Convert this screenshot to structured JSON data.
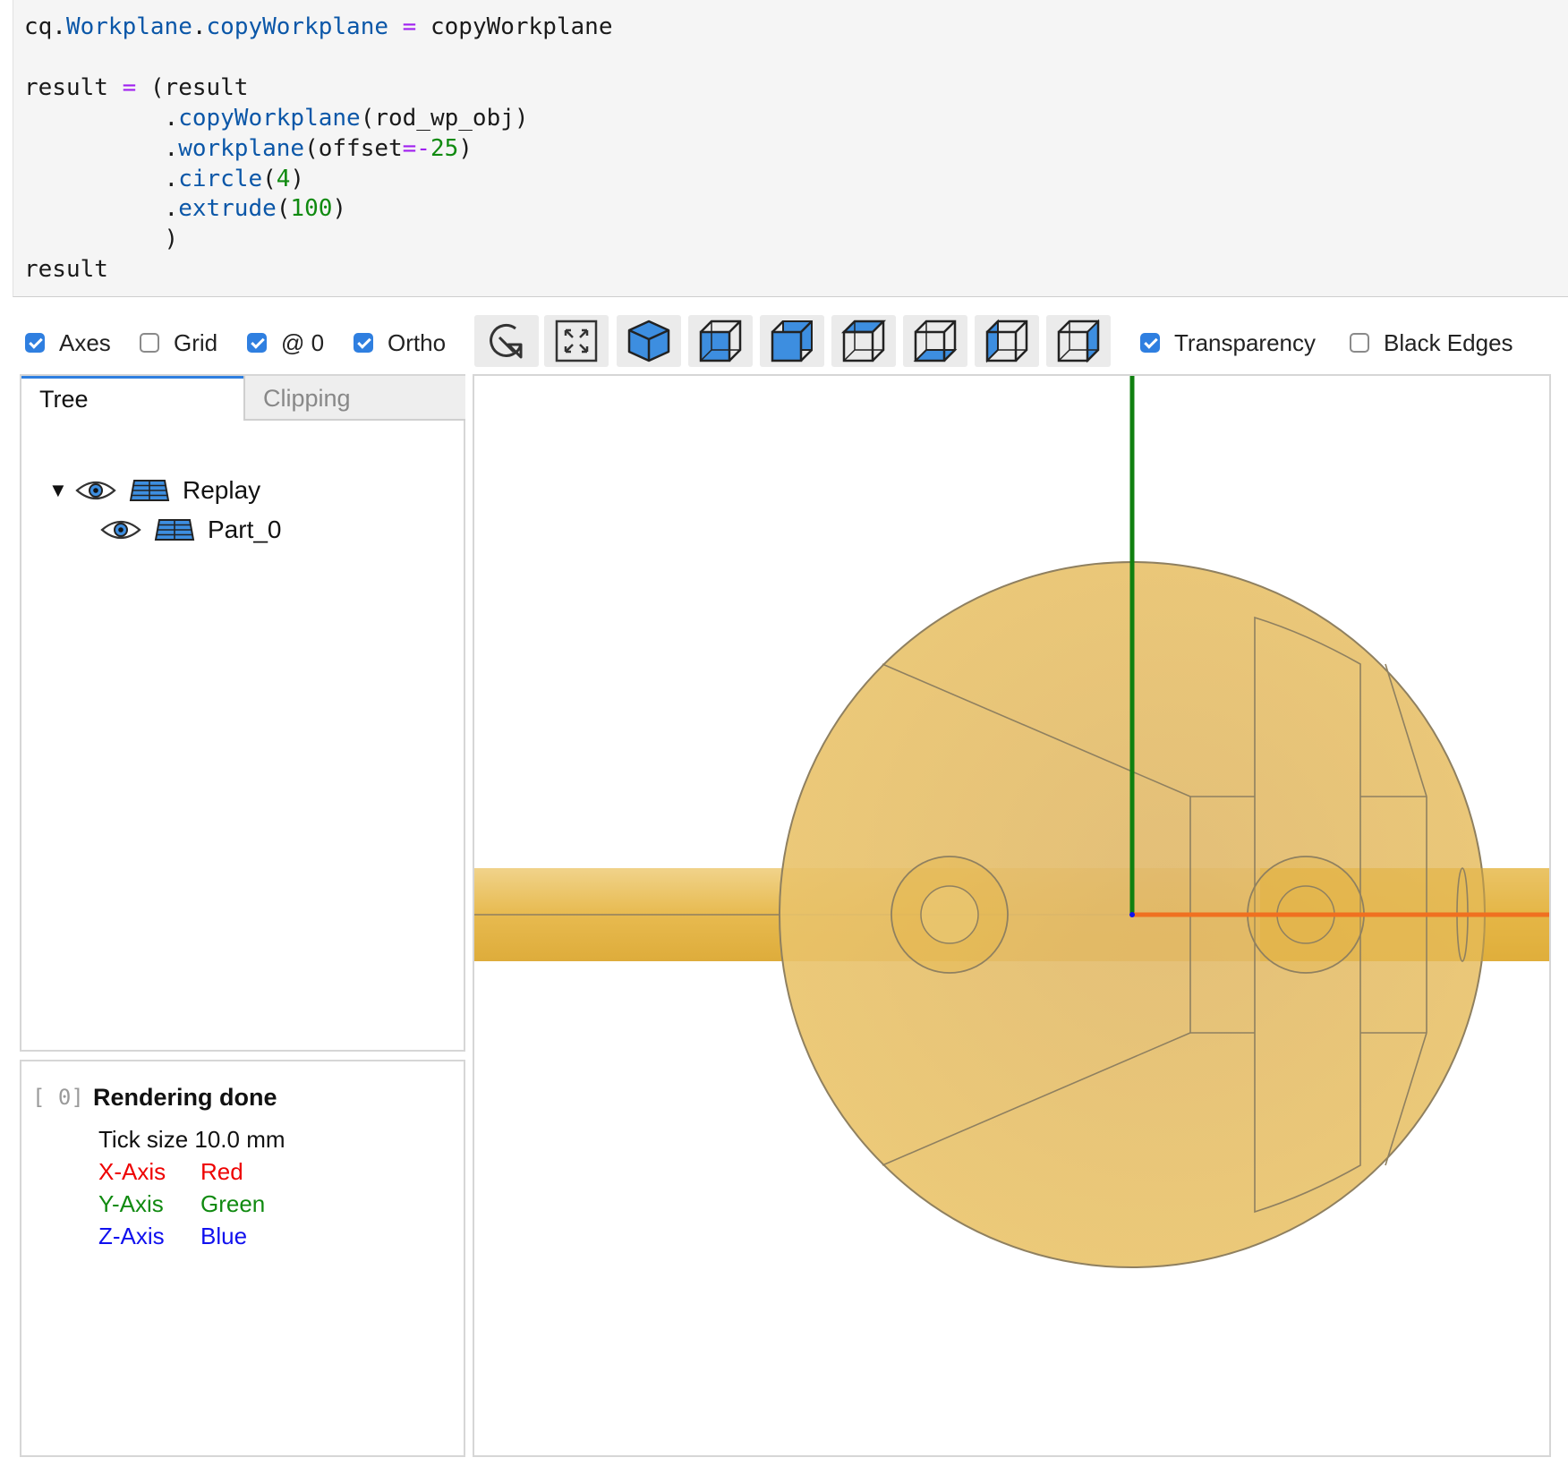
{
  "code": {
    "line1": {
      "a": "cq.",
      "b": "Workplane",
      "c": ".",
      "d": "copyWorkplane",
      "e": " ",
      "op": "=",
      "f": " copyWorkplane"
    },
    "line3": {
      "a": "result ",
      "op": "=",
      "b": " (result"
    },
    "line4": {
      "indent": "          .",
      "fn": "copyWorkplane",
      "rest": "(rod_wp_obj)"
    },
    "line5": {
      "indent": "          .",
      "fn": "workplane",
      "open": "(offset",
      "op": "=-",
      "num": "25",
      "close": ")"
    },
    "line6": {
      "indent": "          .",
      "fn": "circle",
      "open": "(",
      "num": "4",
      "close": ")"
    },
    "line7": {
      "indent": "          .",
      "fn": "extrude",
      "open": "(",
      "num": "100",
      "close": ")"
    },
    "line8": {
      "text": "          )"
    },
    "line9": {
      "text": "result"
    }
  },
  "toolbar": {
    "axes": {
      "label": "Axes",
      "checked": true
    },
    "grid": {
      "label": "Grid",
      "checked": false
    },
    "at0": {
      "label": "@ 0",
      "checked": true
    },
    "ortho": {
      "label": "Ortho",
      "checked": true
    },
    "buttons": [
      "reset-icon",
      "fit-icon",
      "iso-view-icon",
      "front-view-icon",
      "rear-view-icon",
      "top-view-icon",
      "bottom-view-icon",
      "left-view-icon",
      "right-view-icon"
    ],
    "transparency": {
      "label": "Transparency",
      "checked": true
    },
    "black_edges": {
      "label": "Black Edges",
      "checked": false
    }
  },
  "tabs": {
    "tree": "Tree",
    "clipping": "Clipping"
  },
  "tree": {
    "root": {
      "label": "Replay",
      "icon": "shapes-icon"
    },
    "child": {
      "label": "Part_0",
      "icon": "shape-icon"
    }
  },
  "info": {
    "index": "[ 0]",
    "title": "Rendering done",
    "tick": "Tick size 10.0 mm",
    "axes": [
      {
        "axis": "X-Axis",
        "color_name": "Red",
        "color": "#ee0000"
      },
      {
        "axis": "Y-Axis",
        "color_name": "Green",
        "color": "#108a10"
      },
      {
        "axis": "Z-Axis",
        "color_name": "Blue",
        "color": "#1010ee"
      }
    ]
  },
  "colors": {
    "accent": "#2f7fe0",
    "part_fill": "#e8c165",
    "rod_fill": "#e3b23c",
    "edge": "#8f8060",
    "x_axis": "#f07020",
    "y_axis": "#108010"
  }
}
